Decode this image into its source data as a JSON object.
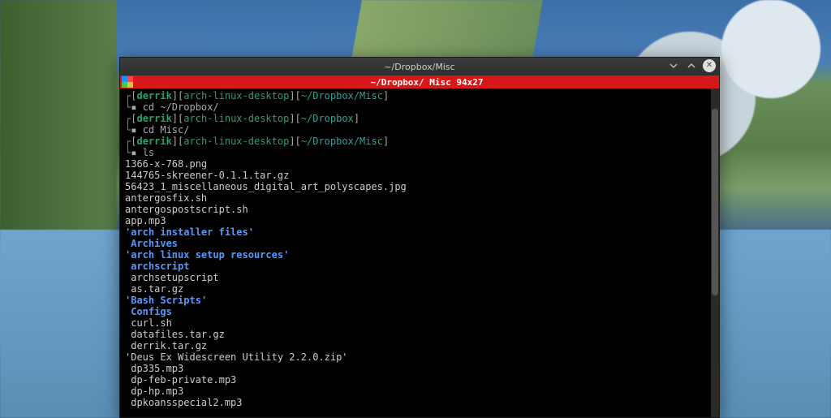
{
  "window": {
    "title": "~/Dropbox/Misc",
    "tab_label": "~/Dropbox/ Misc 94x27"
  },
  "prompts": [
    {
      "user": "derrik",
      "host": "arch-linux-desktop",
      "path": "~/Dropbox/Misc",
      "cmd": "cd ~/Dropbox/"
    },
    {
      "user": "derrik",
      "host": "arch-linux-desktop",
      "path": "~/Dropbox",
      "cmd": "cd Misc/"
    },
    {
      "user": "derrik",
      "host": "arch-linux-desktop",
      "path": "~/Dropbox/Misc",
      "cmd": "ls"
    }
  ],
  "listing": [
    {
      "name": "1366-x-768.png",
      "type": "file"
    },
    {
      "name": "144765-skreener-0.1.1.tar.gz",
      "type": "file"
    },
    {
      "name": "56423_1_miscellaneous_digital_art_polyscapes.jpg",
      "type": "file"
    },
    {
      "name": "antergosfix.sh",
      "type": "file"
    },
    {
      "name": "antergospostscript.sh",
      "type": "file"
    },
    {
      "name": "app.mp3",
      "type": "file"
    },
    {
      "name": "'arch installer files'",
      "type": "dir"
    },
    {
      "name": " Archives",
      "type": "dir"
    },
    {
      "name": "'arch linux setup resources'",
      "type": "dir"
    },
    {
      "name": " archscript",
      "type": "dir"
    },
    {
      "name": " archsetupscript",
      "type": "file"
    },
    {
      "name": " as.tar.gz",
      "type": "file"
    },
    {
      "name": "'Bash Scripts'",
      "type": "dir"
    },
    {
      "name": " Configs",
      "type": "dir"
    },
    {
      "name": " curl.sh",
      "type": "file"
    },
    {
      "name": " datafiles.tar.gz",
      "type": "file"
    },
    {
      "name": " derrik.tar.gz",
      "type": "file"
    },
    {
      "name": "'Deus Ex Widescreen Utility 2.2.0.zip'",
      "type": "file"
    },
    {
      "name": " dp335.mp3",
      "type": "file"
    },
    {
      "name": " dp-feb-private.mp3",
      "type": "file"
    },
    {
      "name": " dp-hp.mp3",
      "type": "file"
    },
    {
      "name": " dpkoansspecial2.mp3",
      "type": "file"
    }
  ],
  "glyphs": {
    "corner_top": "┌",
    "corner_bot": "└",
    "bullet": "▪"
  }
}
